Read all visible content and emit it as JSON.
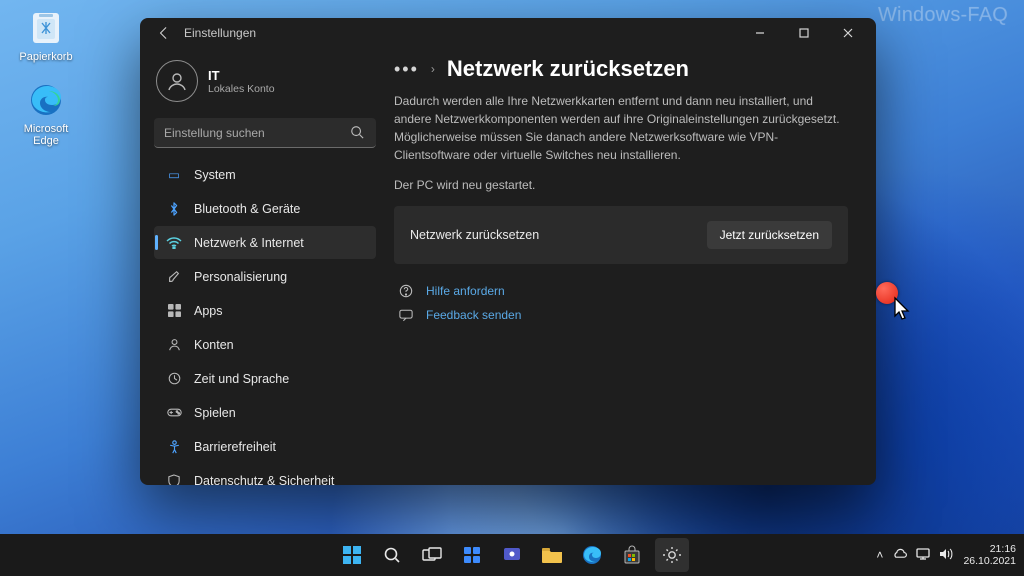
{
  "watermark": "Windows-FAQ",
  "desktop_icons": [
    {
      "label": "Papierkorb"
    },
    {
      "label": "Microsoft Edge"
    }
  ],
  "window": {
    "title": "Einstellungen",
    "account": {
      "name": "IT",
      "sub": "Lokales Konto"
    },
    "search": {
      "placeholder": "Einstellung suchen"
    },
    "sidebar": {
      "items": [
        {
          "label": "System"
        },
        {
          "label": "Bluetooth & Geräte"
        },
        {
          "label": "Netzwerk & Internet"
        },
        {
          "label": "Personalisierung"
        },
        {
          "label": "Apps"
        },
        {
          "label": "Konten"
        },
        {
          "label": "Zeit und Sprache"
        },
        {
          "label": "Spielen"
        },
        {
          "label": "Barrierefreiheit"
        },
        {
          "label": "Datenschutz & Sicherheit"
        }
      ],
      "active_index": 2
    },
    "main": {
      "breadcrumb_more": "…",
      "title": "Netzwerk zurücksetzen",
      "desc": "Dadurch werden alle Ihre Netzwerkkarten entfernt und dann neu installiert, und andere Netzwerkkomponenten werden auf ihre Originaleinstellungen zurückgesetzt. Möglicherweise müssen Sie danach andere Netzwerksoftware wie VPN-Clientsoftware oder virtuelle Switches neu installieren.",
      "restart_note": "Der PC wird neu gestartet.",
      "card": {
        "label": "Netzwerk zurücksetzen",
        "button": "Jetzt zurücksetzen"
      },
      "links": {
        "help": "Hilfe anfordern",
        "feedback": "Feedback senden"
      }
    }
  },
  "taskbar": {
    "clock": {
      "time": "21:16",
      "date": "26.10.2021"
    }
  }
}
